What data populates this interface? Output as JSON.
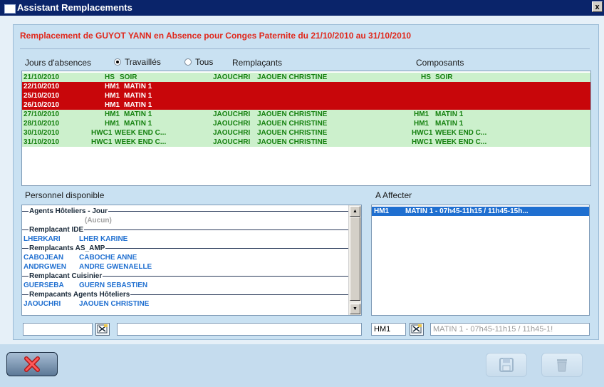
{
  "window": {
    "title": "Assistant Remplacements",
    "close_glyph": "x"
  },
  "header": {
    "text": "Remplacement de GUYOT YANN en Absence pour Conges Paternite du 21/10/2010 au 31/10/2010",
    "color": "#e0281c"
  },
  "absences_section": {
    "label": "Jours d'absences",
    "radio_options": [
      {
        "label": "Travaillés",
        "checked": true
      },
      {
        "label": "Tous",
        "checked": false
      }
    ],
    "col_remplacants": "Remplaçants",
    "col_composants": "Composants",
    "rows": [
      {
        "date": "21/10/2010",
        "code": "HS",
        "desc": "SOIR",
        "agent_code": "JAOUCHRI",
        "agent_name": "JAOUEN CHRISTINE",
        "comp_code": "HS",
        "comp_desc": "SOIR",
        "status": "green"
      },
      {
        "date": "22/10/2010",
        "code": "HM1",
        "desc": "MATIN 1",
        "agent_code": "",
        "agent_name": "",
        "comp_code": "",
        "comp_desc": "",
        "status": "red"
      },
      {
        "date": "25/10/2010",
        "code": "HM1",
        "desc": "MATIN 1",
        "agent_code": "",
        "agent_name": "",
        "comp_code": "",
        "comp_desc": "",
        "status": "red"
      },
      {
        "date": "26/10/2010",
        "code": "HM1",
        "desc": "MATIN 1",
        "agent_code": "",
        "agent_name": "",
        "comp_code": "",
        "comp_desc": "",
        "status": "red"
      },
      {
        "date": "27/10/2010",
        "code": "HM1",
        "desc": "MATIN 1",
        "agent_code": "JAOUCHRI",
        "agent_name": "JAOUEN CHRISTINE",
        "comp_code": "HM1",
        "comp_desc": "MATIN 1",
        "status": "green"
      },
      {
        "date": "28/10/2010",
        "code": "HM1",
        "desc": "MATIN 1",
        "agent_code": "JAOUCHRI",
        "agent_name": "JAOUEN CHRISTINE",
        "comp_code": "HM1",
        "comp_desc": "MATIN 1",
        "status": "green"
      },
      {
        "date": "30/10/2010",
        "code": "HWC1",
        "desc": "WEEK END C...",
        "agent_code": "JAOUCHRI",
        "agent_name": "JAOUEN CHRISTINE",
        "comp_code": "HWC1",
        "comp_desc": "WEEK END C...",
        "status": "green"
      },
      {
        "date": "31/10/2010",
        "code": "HWC1",
        "desc": "WEEK END C...",
        "agent_code": "JAOUCHRI",
        "agent_name": "JAOUEN CHRISTINE",
        "comp_code": "HWC1",
        "comp_desc": "WEEK END C...",
        "status": "green"
      }
    ]
  },
  "personnel": {
    "label": "Personnel disponible",
    "items": [
      {
        "type": "group",
        "label": "Agents Hôteliers - Jour"
      },
      {
        "type": "empty",
        "label": "(Aucun)"
      },
      {
        "type": "group",
        "label": "Remplacant IDE"
      },
      {
        "type": "agent",
        "code": "LHERKARI",
        "name": "LHER KARINE"
      },
      {
        "type": "group",
        "label": "Remplacants AS_AMP"
      },
      {
        "type": "agent",
        "code": "CABOJEAN",
        "name": "CABOCHE ANNE"
      },
      {
        "type": "agent",
        "code": "ANDRGWEN",
        "name": "ANDRE GWENAELLE"
      },
      {
        "type": "group",
        "label": "Remplacant Cuisinier"
      },
      {
        "type": "agent",
        "code": "GUERSEBA",
        "name": "GUERN SEBASTIEN"
      },
      {
        "type": "group",
        "label": "Rempacants Agents Hôteliers"
      },
      {
        "type": "agent",
        "code": "JAOUCHRI",
        "name": "JAOUEN CHRISTINE"
      }
    ],
    "search_code_value": "",
    "search_name_value": ""
  },
  "affecter": {
    "label": "A Affecter",
    "selected_row": {
      "code": "HM1",
      "desc": "MATIN 1 - 07h45-11h15 / 11h45-15h..."
    },
    "code_field": "HM1",
    "desc_field": "MATIN 1 - 07h45-11h15 / 11h45-1!"
  },
  "footer": {
    "cancel_icon": "x-icon",
    "save_icon": "floppy-icon",
    "delete_icon": "trash-icon"
  },
  "colors": {
    "green_row_bg": "#ccf0cc",
    "green_row_text": "#15810f",
    "red_row_bg": "#c8060a",
    "agent_text": "#1f6fd0",
    "selection_bg": "#1f6fd0"
  }
}
